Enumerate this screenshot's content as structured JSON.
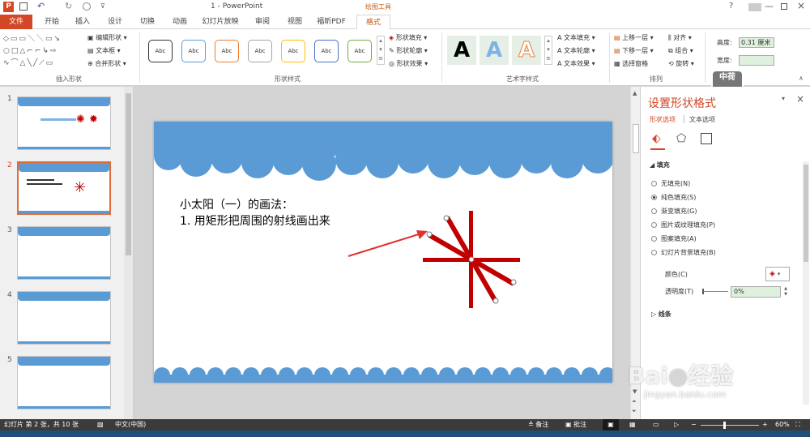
{
  "window": {
    "title": "1 - PowerPoint",
    "context_tab": "绘图工具"
  },
  "tabs": [
    "文件",
    "开始",
    "插入",
    "设计",
    "切换",
    "动画",
    "幻灯片放映",
    "审阅",
    "视图",
    "福昕PDF",
    "格式"
  ],
  "ribbon": {
    "insert_shapes": {
      "label": "插入形状",
      "edit_shape": "编辑形状",
      "textbox": "文本框",
      "merge_shapes": "合并形状"
    },
    "shape_styles": {
      "label": "形状样式",
      "swatch_text": "Abc",
      "fill": "形状填充",
      "outline": "形状轮廓",
      "effects": "形状效果",
      "swatch_colors": [
        "#333333",
        "#5b9bd5",
        "#ed7d31",
        "#a5a5a5",
        "#ffc000",
        "#4472c4",
        "#70ad47"
      ]
    },
    "wordart": {
      "label": "艺术字样式",
      "sample": "A",
      "text_fill": "文本填充",
      "text_outline": "文本轮廓",
      "text_effects": "文本效果"
    },
    "arrange": {
      "label": "排列",
      "bring_forward": "上移一层",
      "send_backward": "下移一层",
      "selection_pane": "选择窗格",
      "align": "对齐",
      "group": "组合",
      "rotate": "旋转"
    },
    "size": {
      "height_label": "高度:",
      "height_value": "0.31 厘米",
      "width_label": "宽度:"
    }
  },
  "slides": [
    {
      "num": "1"
    },
    {
      "num": "2"
    },
    {
      "num": "3"
    },
    {
      "num": "4"
    },
    {
      "num": "5"
    }
  ],
  "slide": {
    "line1": "小太阳（一）的画法：",
    "line2": "1. 用矩形把周围的射线画出来"
  },
  "format_panel": {
    "title": "设置形状格式",
    "tab_shape": "形状选项",
    "tab_text": "文本选项",
    "section_fill": "填充",
    "options": [
      "无填充(N)",
      "纯色填充(S)",
      "渐变填充(G)",
      "图片或纹理填充(P)",
      "图案填充(A)",
      "幻灯片背景填充(B)"
    ],
    "selected_option": 1,
    "color_label": "颜色(C)",
    "transparency_label": "透明度(T)",
    "transparency_value": "0%",
    "section_line": "线条"
  },
  "statusbar": {
    "slide_info": "幻灯片 第 2 张，共 10 张",
    "language": "中文(中国)",
    "notes": "备注",
    "comments": "批注",
    "zoom": "60%"
  },
  "colors": {
    "accent": "#d24726",
    "ribbon_accent": "#c55a11",
    "slide_blue": "#5b9bd5",
    "ray_red": "#c00000",
    "status_bg": "#3b3b3b"
  }
}
